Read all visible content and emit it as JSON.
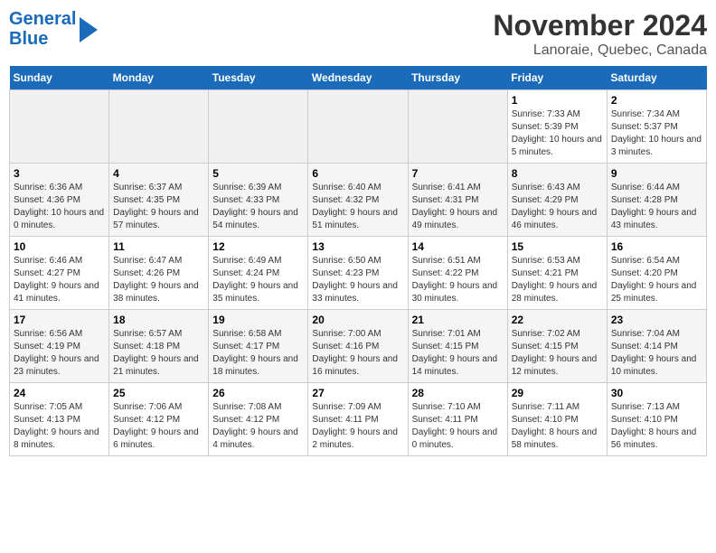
{
  "logo": {
    "line1": "General",
    "line2": "Blue"
  },
  "title": "November 2024",
  "subtitle": "Lanoraie, Quebec, Canada",
  "days_of_week": [
    "Sunday",
    "Monday",
    "Tuesday",
    "Wednesday",
    "Thursday",
    "Friday",
    "Saturday"
  ],
  "weeks": [
    [
      {
        "day": "",
        "info": ""
      },
      {
        "day": "",
        "info": ""
      },
      {
        "day": "",
        "info": ""
      },
      {
        "day": "",
        "info": ""
      },
      {
        "day": "",
        "info": ""
      },
      {
        "day": "1",
        "info": "Sunrise: 7:33 AM\nSunset: 5:39 PM\nDaylight: 10 hours and 5 minutes."
      },
      {
        "day": "2",
        "info": "Sunrise: 7:34 AM\nSunset: 5:37 PM\nDaylight: 10 hours and 3 minutes."
      }
    ],
    [
      {
        "day": "3",
        "info": "Sunrise: 6:36 AM\nSunset: 4:36 PM\nDaylight: 10 hours and 0 minutes."
      },
      {
        "day": "4",
        "info": "Sunrise: 6:37 AM\nSunset: 4:35 PM\nDaylight: 9 hours and 57 minutes."
      },
      {
        "day": "5",
        "info": "Sunrise: 6:39 AM\nSunset: 4:33 PM\nDaylight: 9 hours and 54 minutes."
      },
      {
        "day": "6",
        "info": "Sunrise: 6:40 AM\nSunset: 4:32 PM\nDaylight: 9 hours and 51 minutes."
      },
      {
        "day": "7",
        "info": "Sunrise: 6:41 AM\nSunset: 4:31 PM\nDaylight: 9 hours and 49 minutes."
      },
      {
        "day": "8",
        "info": "Sunrise: 6:43 AM\nSunset: 4:29 PM\nDaylight: 9 hours and 46 minutes."
      },
      {
        "day": "9",
        "info": "Sunrise: 6:44 AM\nSunset: 4:28 PM\nDaylight: 9 hours and 43 minutes."
      }
    ],
    [
      {
        "day": "10",
        "info": "Sunrise: 6:46 AM\nSunset: 4:27 PM\nDaylight: 9 hours and 41 minutes."
      },
      {
        "day": "11",
        "info": "Sunrise: 6:47 AM\nSunset: 4:26 PM\nDaylight: 9 hours and 38 minutes."
      },
      {
        "day": "12",
        "info": "Sunrise: 6:49 AM\nSunset: 4:24 PM\nDaylight: 9 hours and 35 minutes."
      },
      {
        "day": "13",
        "info": "Sunrise: 6:50 AM\nSunset: 4:23 PM\nDaylight: 9 hours and 33 minutes."
      },
      {
        "day": "14",
        "info": "Sunrise: 6:51 AM\nSunset: 4:22 PM\nDaylight: 9 hours and 30 minutes."
      },
      {
        "day": "15",
        "info": "Sunrise: 6:53 AM\nSunset: 4:21 PM\nDaylight: 9 hours and 28 minutes."
      },
      {
        "day": "16",
        "info": "Sunrise: 6:54 AM\nSunset: 4:20 PM\nDaylight: 9 hours and 25 minutes."
      }
    ],
    [
      {
        "day": "17",
        "info": "Sunrise: 6:56 AM\nSunset: 4:19 PM\nDaylight: 9 hours and 23 minutes."
      },
      {
        "day": "18",
        "info": "Sunrise: 6:57 AM\nSunset: 4:18 PM\nDaylight: 9 hours and 21 minutes."
      },
      {
        "day": "19",
        "info": "Sunrise: 6:58 AM\nSunset: 4:17 PM\nDaylight: 9 hours and 18 minutes."
      },
      {
        "day": "20",
        "info": "Sunrise: 7:00 AM\nSunset: 4:16 PM\nDaylight: 9 hours and 16 minutes."
      },
      {
        "day": "21",
        "info": "Sunrise: 7:01 AM\nSunset: 4:15 PM\nDaylight: 9 hours and 14 minutes."
      },
      {
        "day": "22",
        "info": "Sunrise: 7:02 AM\nSunset: 4:15 PM\nDaylight: 9 hours and 12 minutes."
      },
      {
        "day": "23",
        "info": "Sunrise: 7:04 AM\nSunset: 4:14 PM\nDaylight: 9 hours and 10 minutes."
      }
    ],
    [
      {
        "day": "24",
        "info": "Sunrise: 7:05 AM\nSunset: 4:13 PM\nDaylight: 9 hours and 8 minutes."
      },
      {
        "day": "25",
        "info": "Sunrise: 7:06 AM\nSunset: 4:12 PM\nDaylight: 9 hours and 6 minutes."
      },
      {
        "day": "26",
        "info": "Sunrise: 7:08 AM\nSunset: 4:12 PM\nDaylight: 9 hours and 4 minutes."
      },
      {
        "day": "27",
        "info": "Sunrise: 7:09 AM\nSunset: 4:11 PM\nDaylight: 9 hours and 2 minutes."
      },
      {
        "day": "28",
        "info": "Sunrise: 7:10 AM\nSunset: 4:11 PM\nDaylight: 9 hours and 0 minutes."
      },
      {
        "day": "29",
        "info": "Sunrise: 7:11 AM\nSunset: 4:10 PM\nDaylight: 8 hours and 58 minutes."
      },
      {
        "day": "30",
        "info": "Sunrise: 7:13 AM\nSunset: 4:10 PM\nDaylight: 8 hours and 56 minutes."
      }
    ]
  ]
}
